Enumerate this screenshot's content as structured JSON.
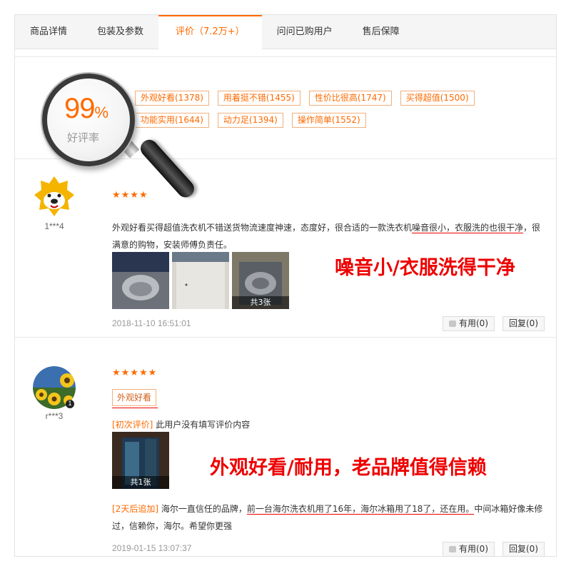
{
  "tabs": [
    {
      "label": "商品详情"
    },
    {
      "label": "包装及参数"
    },
    {
      "label": "评价（7.2万+）"
    },
    {
      "label": "问问已购用户"
    },
    {
      "label": "售后保障"
    }
  ],
  "summary": {
    "percent": "99",
    "percent_sign": "%",
    "rate_label": "好评率",
    "tags": [
      {
        "label": "外观好看(1378)"
      },
      {
        "label": "用着挺不错(1455)"
      },
      {
        "label": "性价比很高(1747)"
      },
      {
        "label": "买得超值(1500)"
      },
      {
        "label": "功能实用(1644)"
      },
      {
        "label": "动力足(1394)"
      },
      {
        "label": "操作简单(1552)"
      }
    ]
  },
  "reviews": [
    {
      "user": "1***4",
      "stars": "★★★★",
      "text_a": "外观好看买得超值洗衣机不错送货物流速度神速，态度好，很合适的一款洗衣机",
      "text_b": "噪音很小，衣服洗的也很干净",
      "text_c": "，很满意的购物，安装师傅负责任。",
      "image_count": "共3张",
      "date": "2018-11-10 16:51:01",
      "helpful": "有用(0)",
      "reply": "回复(0)",
      "highlight": "噪音小/衣服洗得干净"
    },
    {
      "user": "r***3",
      "stars": "★★★★★",
      "tag": "外观好看",
      "first_label": "[初次评价]",
      "first_text": "此用户没有填写评价内容",
      "image_count": "共1张",
      "follow_label": "[2天后追加]",
      "follow_a": "海尔一直信任的品牌，",
      "follow_b": "前一台海尔洗衣机用了16年，海尔冰箱用了18了，还在用。",
      "follow_c": "中间冰箱好像未修过，信赖你，海尔。希望你更强",
      "date": "2019-01-15 13:07:37",
      "helpful": "有用(0)",
      "reply": "回复(0)",
      "highlight": "外观好看/耐用，老品牌值得信赖"
    }
  ],
  "colors": {
    "accent": "#ff6a00",
    "highlight": "#ee0000"
  }
}
